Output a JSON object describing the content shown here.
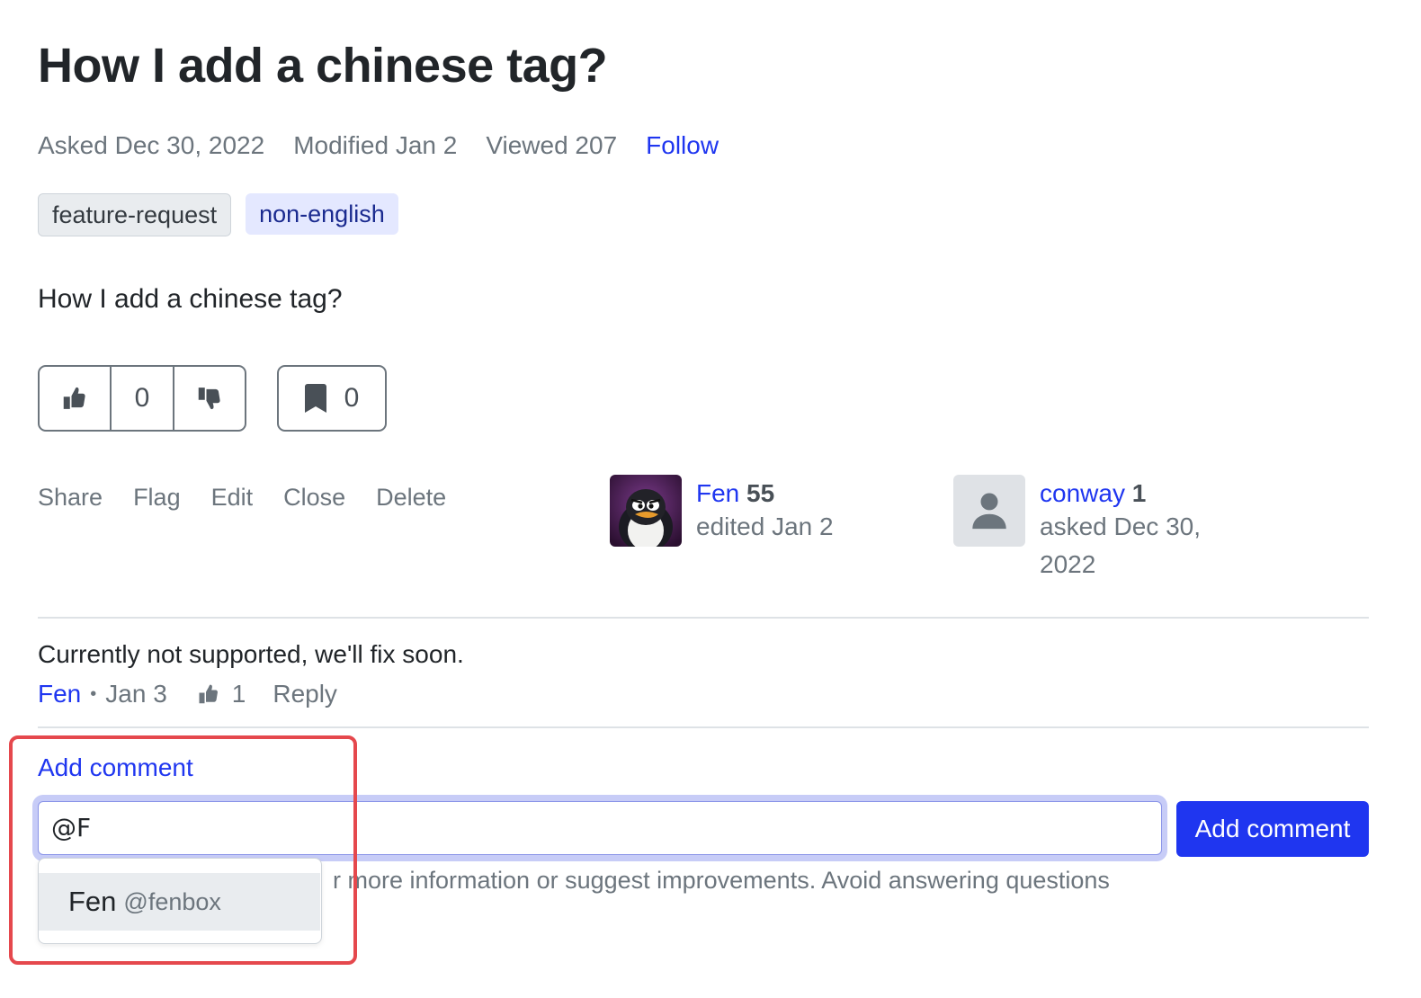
{
  "question": {
    "title": "How I add a chinese tag?",
    "meta": {
      "asked_label": "Asked",
      "asked_value": "Dec 30, 2022",
      "modified_label": "Modified",
      "modified_value": "Jan 2",
      "viewed_label": "Viewed",
      "viewed_value": "207",
      "follow_label": "Follow"
    },
    "tags": [
      "feature-request",
      "non-english"
    ],
    "body": "How I add a chinese tag?",
    "votes": "0",
    "bookmarks": "0",
    "actions": [
      "Share",
      "Flag",
      "Edit",
      "Close",
      "Delete"
    ],
    "editor": {
      "name": "Fen",
      "reputation": "55",
      "action": "edited Jan 2"
    },
    "asker": {
      "name": "conway",
      "reputation": "1",
      "action_line1": "asked Dec 30,",
      "action_line2": "2022"
    }
  },
  "comment": {
    "text": "Currently not supported, we'll fix soon.",
    "author": "Fen",
    "separator": "•",
    "date": "Jan 3",
    "likes": "1",
    "reply_label": "Reply"
  },
  "add_comment": {
    "link_label": "Add comment",
    "input_value": "@F",
    "submit_label": "Add comment",
    "helper_text": "r more information or suggest improvements. Avoid answering questions",
    "mention_suggestion": {
      "name": "Fen",
      "handle": "@fenbox"
    }
  },
  "colors": {
    "link": "#1f36f0",
    "highlight": "#e5484d"
  }
}
